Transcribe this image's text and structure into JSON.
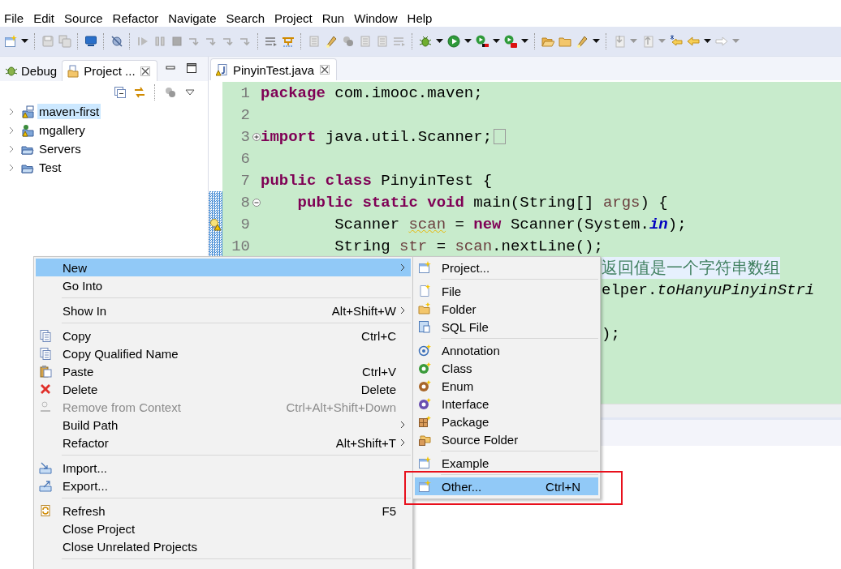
{
  "menu_bar": [
    "File",
    "Edit",
    "Source",
    "Refactor",
    "Navigate",
    "Search",
    "Project",
    "Run",
    "Window",
    "Help"
  ],
  "left_panel": {
    "tabs": [
      {
        "label": "Debug",
        "selected": false
      },
      {
        "label": "Project ...",
        "selected": true
      }
    ],
    "tree": [
      {
        "label": "maven-first",
        "selected": true
      },
      {
        "label": "mgallery",
        "selected": false
      },
      {
        "label": "Servers",
        "selected": false
      },
      {
        "label": "Test",
        "selected": false
      }
    ]
  },
  "editor": {
    "tab": {
      "label": "PinyinTest.java",
      "selected": true
    },
    "lines": [
      {
        "kind": "line",
        "number": "1",
        "changed": false,
        "warning": false,
        "foldable": false,
        "segments": [
          {
            "kind": "keyword",
            "text": "package"
          },
          {
            "kind": "plain",
            "text": " com.imooc.maven;"
          }
        ]
      },
      {
        "kind": "line",
        "number": "2",
        "changed": false,
        "warning": false,
        "foldable": false
      },
      {
        "kind": "line",
        "number": "3",
        "changed": false,
        "warning": false,
        "foldable": true,
        "collapsed": true,
        "segments": [
          {
            "kind": "keyword",
            "text": "import"
          },
          {
            "kind": "plain",
            "text": " java.util.Scanner;"
          }
        ]
      },
      {
        "kind": "line",
        "number": "6",
        "changed": false,
        "warning": false,
        "foldable": false
      },
      {
        "kind": "line",
        "number": "7",
        "changed": false,
        "warning": false,
        "foldable": false,
        "segments": [
          {
            "kind": "keyword",
            "text": "public class"
          },
          {
            "kind": "plain",
            "text": " PinyinTest {"
          }
        ]
      },
      {
        "kind": "line",
        "number": "8",
        "changed": true,
        "warning": false,
        "foldable": true,
        "collapsed": false,
        "segments": [
          {
            "kind": "keyword",
            "text": "    public static void"
          },
          {
            "kind": "plain",
            "text": " main(String[] "
          },
          {
            "kind": "variable",
            "text": "args"
          },
          {
            "kind": "plain",
            "text": ") {"
          }
        ]
      },
      {
        "kind": "line",
        "number": "9",
        "changed": true,
        "warning": true,
        "foldable": false,
        "segments": [
          {
            "kind": "plain",
            "text": "        Scanner "
          },
          {
            "kind": "warned",
            "text": "scan"
          },
          {
            "kind": "plain",
            "text": " = "
          },
          {
            "kind": "keyword",
            "text": "new"
          },
          {
            "kind": "plain",
            "text": " Scanner(System."
          },
          {
            "kind": "field",
            "text": "in"
          },
          {
            "kind": "plain",
            "text": ");"
          }
        ]
      },
      {
        "kind": "line",
        "number": "10",
        "changed": true,
        "warning": false,
        "foldable": false,
        "segments": [
          {
            "kind": "plain",
            "text": "        String "
          },
          {
            "kind": "variable",
            "text": "str"
          },
          {
            "kind": "plain",
            "text": " = "
          },
          {
            "kind": "variable",
            "text": "scan"
          },
          {
            "kind": "plain",
            "text": ".nextLine();"
          }
        ]
      },
      {
        "kind": "fragment",
        "highlighted": true,
        "segments": [
          {
            "kind": "comment",
            "text": "返回值是一个字符串数组"
          }
        ]
      },
      {
        "kind": "fragment",
        "highlighted": false,
        "segments": [
          {
            "kind": "plain",
            "text": "elper."
          },
          {
            "kind": "static",
            "text": "toHanyuPinyinStri"
          }
        ]
      },
      {
        "kind": "fragment"
      },
      {
        "kind": "fragment",
        "highlighted": false,
        "segments": [
          {
            "kind": "plain",
            "text": ");"
          }
        ]
      }
    ]
  },
  "context_menu": {
    "groups": [
      [
        {
          "label": "New",
          "selected": true,
          "disabled": false,
          "submenu": true
        },
        {
          "label": "Go Into",
          "selected": false,
          "disabled": false,
          "submenu": false
        }
      ],
      [
        {
          "label": "Show In",
          "shortcut": "Alt+Shift+W",
          "selected": false,
          "disabled": false,
          "submenu": true
        }
      ],
      [
        {
          "label": "Copy",
          "shortcut": "Ctrl+C",
          "selected": false,
          "disabled": false,
          "submenu": false
        },
        {
          "label": "Copy Qualified Name",
          "selected": false,
          "disabled": false,
          "submenu": false
        },
        {
          "label": "Paste",
          "shortcut": "Ctrl+V",
          "selected": false,
          "disabled": false,
          "submenu": false
        },
        {
          "label": "Delete",
          "shortcut": "Delete",
          "selected": false,
          "disabled": false,
          "submenu": false
        },
        {
          "label": "Remove from Context",
          "shortcut": "Ctrl+Alt+Shift+Down",
          "selected": false,
          "disabled": true,
          "submenu": false
        },
        {
          "label": "Build Path",
          "selected": false,
          "disabled": false,
          "submenu": true
        },
        {
          "label": "Refactor",
          "shortcut": "Alt+Shift+T",
          "selected": false,
          "disabled": false,
          "submenu": true
        }
      ],
      [
        {
          "label": "Import...",
          "selected": false,
          "disabled": false,
          "submenu": false
        },
        {
          "label": "Export...",
          "selected": false,
          "disabled": false,
          "submenu": false
        }
      ],
      [
        {
          "label": "Refresh",
          "shortcut": "F5",
          "selected": false,
          "disabled": false,
          "submenu": false
        },
        {
          "label": "Close Project",
          "selected": false,
          "disabled": false,
          "submenu": false
        },
        {
          "label": "Close Unrelated Projects",
          "selected": false,
          "disabled": false,
          "submenu": false
        }
      ]
    ]
  },
  "submenu": {
    "groups": [
      [
        {
          "label": "Project...",
          "selected": false
        }
      ],
      [
        {
          "label": "File",
          "selected": false
        },
        {
          "label": "Folder",
          "selected": false
        },
        {
          "label": "SQL File",
          "selected": false
        }
      ],
      [
        {
          "label": "Annotation",
          "selected": false
        },
        {
          "label": "Class",
          "selected": false
        },
        {
          "label": "Enum",
          "selected": false
        },
        {
          "label": "Interface",
          "selected": false
        },
        {
          "label": "Package",
          "selected": false
        },
        {
          "label": "Source Folder",
          "selected": false
        }
      ],
      [
        {
          "label": "Example",
          "selected": false
        }
      ],
      [
        {
          "label": "Other...",
          "shortcut": "Ctrl+N",
          "selected": true
        }
      ]
    ]
  },
  "annotation": {
    "highlight_frame": true
  }
}
